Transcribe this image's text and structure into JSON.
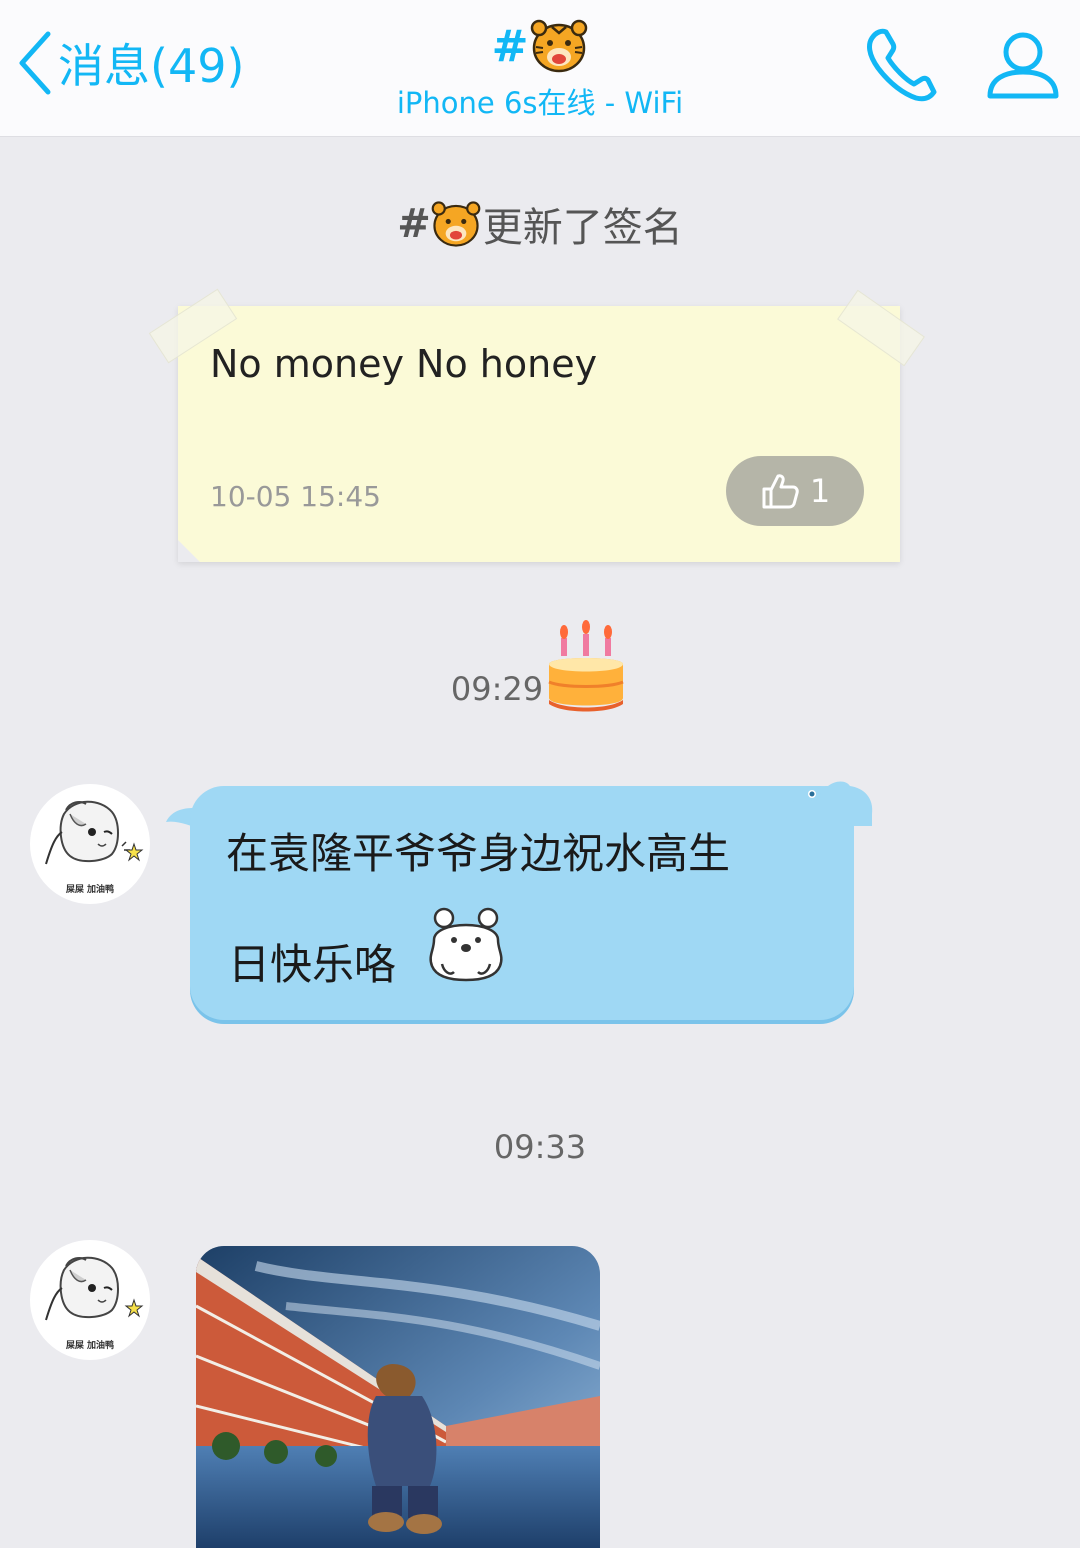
{
  "header": {
    "back_label": "消息(49)",
    "title_hash": "#",
    "status": "iPhone 6s在线 - WiFi"
  },
  "notice": {
    "hash": "#",
    "text": "更新了签名"
  },
  "signature_card": {
    "text": "No money No honey",
    "timestamp": "10-05 15:45",
    "like_count": "1"
  },
  "messages": [
    {
      "time": "09:29",
      "line1": "在袁隆平爷爷身边祝水高生",
      "line2": "日快乐咯",
      "sender_caption": "屎屎 加油鸭"
    },
    {
      "time": "09:33",
      "sender_caption": "屎屎 加油鸭"
    }
  ],
  "icons": {
    "back": "chevron-left-icon",
    "call": "phone-icon",
    "profile": "person-icon",
    "like": "thumbs-up-icon",
    "title_emoji": "tiger-face-icon",
    "cake": "birthday-cake-icon",
    "bear": "polar-bear-sticker-icon"
  },
  "colors": {
    "accent": "#12b7f5",
    "bubble": "#9fd8f4",
    "note": "#fbfad7",
    "background": "#ebebef"
  }
}
